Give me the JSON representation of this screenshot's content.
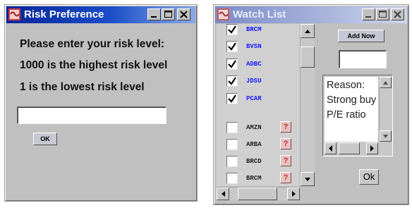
{
  "risk_window": {
    "title": "Risk Preference",
    "prompt_line1": "Please enter your risk level:",
    "prompt_line2": "1000 is the highest risk level",
    "prompt_line3": "1 is the lowest risk level",
    "input_value": "",
    "ok_label": "OK"
  },
  "watch_window": {
    "title": "Watch List",
    "add_label": "Add Now",
    "add_input_value": "",
    "reason_lines": [
      "Reason:",
      "Strong buy",
      "P/E ratio"
    ],
    "ok_label": "Ok",
    "checked_items": [
      {
        "ticker": "BRCM"
      },
      {
        "ticker": "BVSN"
      },
      {
        "ticker": "ADBC"
      },
      {
        "ticker": "JDSU"
      },
      {
        "ticker": "PCAR"
      }
    ],
    "unchecked_items": [
      {
        "ticker": "AMZN",
        "button": "?"
      },
      {
        "ticker": "ARBA",
        "button": "?"
      },
      {
        "ticker": "BRCD",
        "button": "?"
      },
      {
        "ticker": "BRCM",
        "button": "?"
      }
    ]
  },
  "colors": {
    "active_title": "#0a2a9a",
    "inactive_title": "#9aa6d4",
    "ticker_checked": "#1a1aff",
    "ticker_unchecked": "#202020"
  }
}
